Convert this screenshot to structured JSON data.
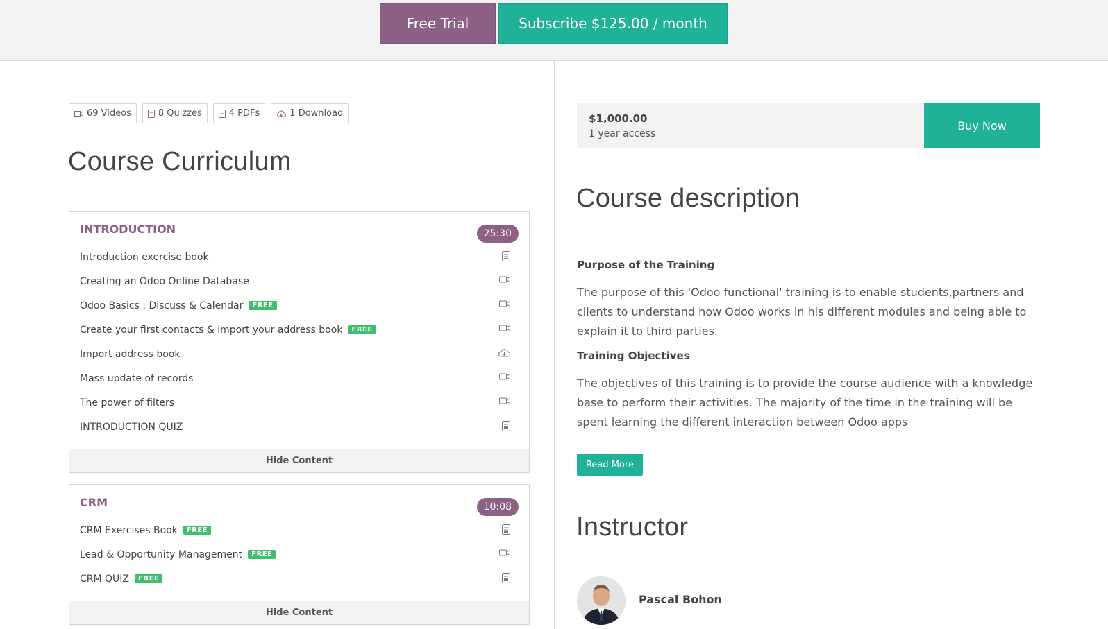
{
  "topbar": {
    "free_trial_label": "Free Trial",
    "subscribe_label": "Subscribe $125.00 / month"
  },
  "stats": [
    {
      "icon": "video-icon",
      "label": "69 Videos"
    },
    {
      "icon": "quiz-icon",
      "label": "8 Quizzes"
    },
    {
      "icon": "pdf-icon",
      "label": "4 PDFs"
    },
    {
      "icon": "cloud-download-icon",
      "label": "1 Download"
    }
  ],
  "curriculum": {
    "title": "Course Curriculum",
    "hide_label": "Hide Content",
    "sections": [
      {
        "title": "INTRODUCTION",
        "duration": "25:30",
        "lessons": [
          {
            "label": "Introduction exercise book",
            "free": false,
            "icon": "document-icon"
          },
          {
            "label": "Creating an Odoo Online Database",
            "free": false,
            "icon": "video-icon"
          },
          {
            "label": "Odoo Basics : Discuss & Calendar",
            "free": true,
            "icon": "video-icon"
          },
          {
            "label": "Create your first contacts & import your address book",
            "free": true,
            "icon": "video-icon"
          },
          {
            "label": "Import address book",
            "free": false,
            "icon": "cloud-download-icon"
          },
          {
            "label": "Mass update of records",
            "free": false,
            "icon": "video-icon"
          },
          {
            "label": "The power of filters",
            "free": false,
            "icon": "video-icon"
          },
          {
            "label": "INTRODUCTION QUIZ",
            "free": false,
            "icon": "quiz-icon"
          }
        ]
      },
      {
        "title": "CRM",
        "duration": "10:08",
        "lessons": [
          {
            "label": "CRM Exercises Book",
            "free": true,
            "icon": "document-icon"
          },
          {
            "label": "Lead & Opportunity Management",
            "free": true,
            "icon": "video-icon"
          },
          {
            "label": "CRM QUIZ",
            "free": true,
            "icon": "quiz-icon"
          }
        ]
      }
    ],
    "free_label": "FREE"
  },
  "purchase": {
    "price": "$1,000.00",
    "access": "1 year access",
    "buy_label": "Buy Now"
  },
  "description": {
    "title": "Course description",
    "purpose_heading": "Purpose of the Training",
    "purpose_text": "The purpose of this 'Odoo functional' training is to enable students,partners and clients to understand how Odoo works in his different modules and being able to explain it to third parties.",
    "objectives_heading": "Training Objectives",
    "objectives_text": "The objectives of this training is to provide the course audience with a knowledge base to perform their activities. The majority of the time in the training will be spent learning the different interaction between Odoo apps",
    "read_more_label": "Read More"
  },
  "instructor": {
    "title": "Instructor",
    "name": "Pascal Bohon"
  },
  "colors": {
    "purple": "#8d6186",
    "teal": "#1fb298",
    "free_green": "#3fbf6c"
  }
}
